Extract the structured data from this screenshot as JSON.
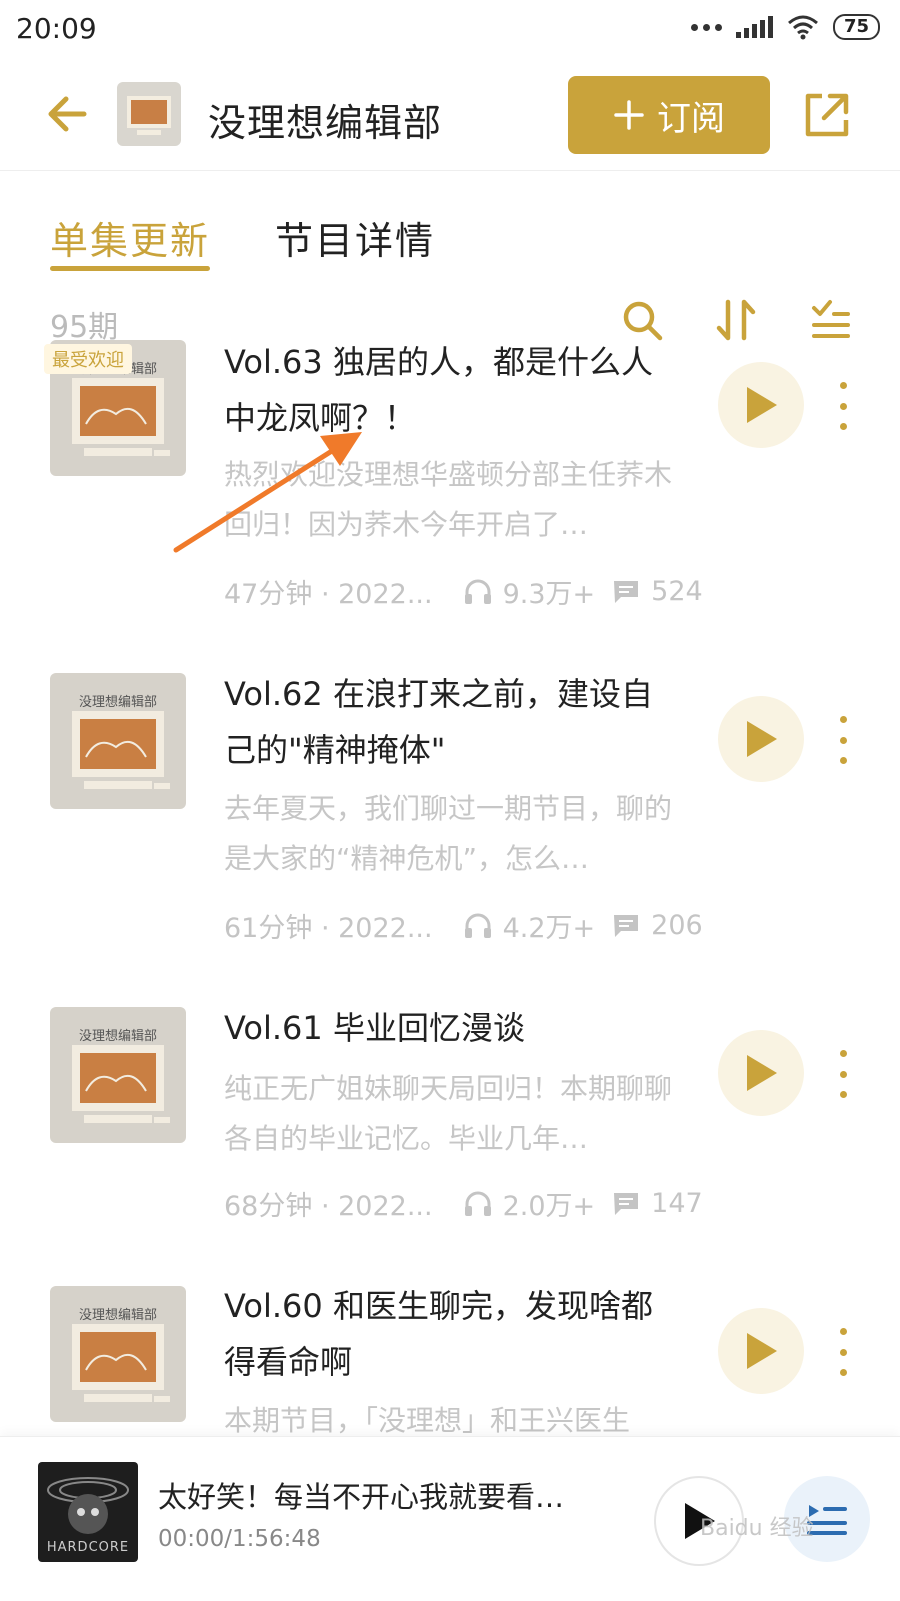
{
  "status_bar": {
    "time": "20:09",
    "battery": "75"
  },
  "header": {
    "title": "没理想编辑部",
    "subscribe_label": "订阅"
  },
  "tabs": [
    {
      "label": "单集更新",
      "active": true
    },
    {
      "label": "节目详情",
      "active": false
    }
  ],
  "list": {
    "count": "95期"
  },
  "cover_caption": "没理想编辑部",
  "episodes": [
    {
      "badge": "最受欢迎",
      "title": "Vol.63 独居的人，都是什么人中龙凤啊？！",
      "desc": "热烈欢迎没理想华盛顿分部主任荞木回归！因为荞木今年开启了…",
      "duration": "47分钟 · 2022...",
      "plays": "9.3万+",
      "comments": "524"
    },
    {
      "title": "Vol.62 在浪打来之前，建设自己的\"精神掩体\"",
      "desc": "去年夏天，我们聊过一期节目，聊的是大家的“精神危机”，怎么…",
      "duration": "61分钟 · 2022...",
      "plays": "4.2万+",
      "comments": "206"
    },
    {
      "title": "Vol.61 毕业回忆漫谈",
      "desc": "纯正无广姐妹聊天局回归！本期聊聊各自的毕业记忆。毕业几年…",
      "duration": "68分钟 · 2022...",
      "plays": "2.0万+",
      "comments": "147"
    },
    {
      "title": "Vol.60 和医生聊完，发现啥都得看命啊",
      "desc": "本期节目，「没理想」和王兴医生"
    }
  ],
  "player": {
    "title": "太好笑！每当不开心我就要看…",
    "time": "00:00/1:56:48",
    "cover_text": "HARDCORE"
  },
  "watermark": "Baidu 经验",
  "colors": {
    "accent": "#c9a33b",
    "annotation_arrow": "#f07a2a"
  }
}
